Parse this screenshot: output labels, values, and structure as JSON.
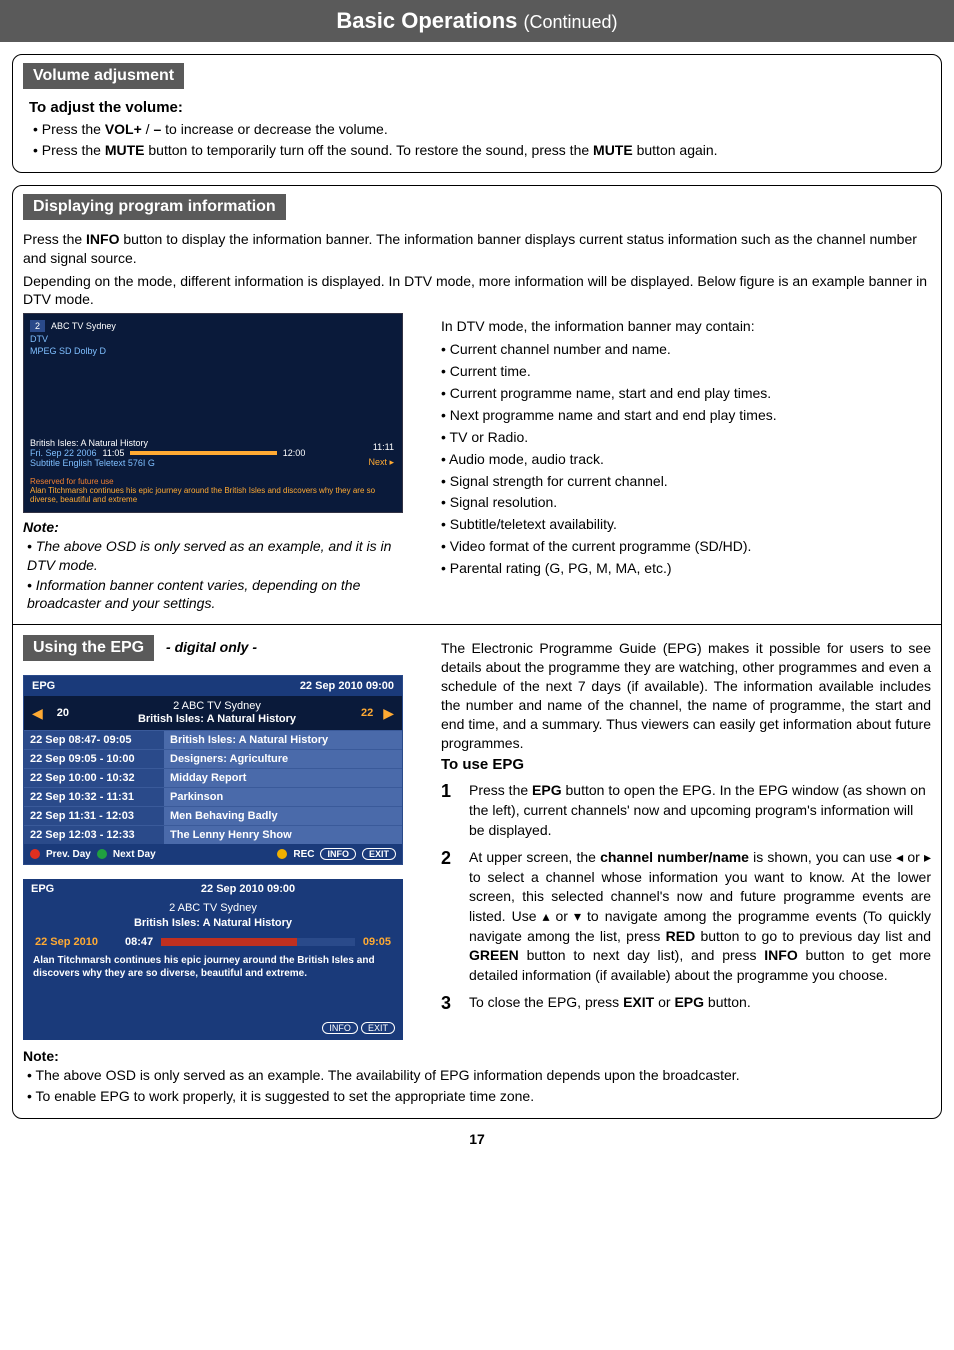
{
  "page": {
    "title_main": "Basic Operations",
    "title_cont": "(Continued)",
    "number": "17"
  },
  "vol": {
    "heading": "Volume adjusment",
    "sub": "To adjust the volume:",
    "b1_a": "Press the ",
    "b1_b": "VOL+",
    "b1_c": " / ",
    "b1_d": "–",
    "b1_e": "  to increase or decrease the volume.",
    "b2_a": "Press the ",
    "b2_b": "MUTE",
    "b2_c": " button to temporarily turn off the sound.   To restore the sound, press the ",
    "b2_d": "MUTE",
    "b2_e": " button again."
  },
  "disp": {
    "heading": "Displaying program information",
    "p1_a": "Press the ",
    "p1_b": "INFO",
    "p1_c": " button to display the information banner. The information banner displays current status information such as the channel number and signal source.",
    "p2": "Depending on the mode, different information is displayed. In DTV mode, more information will be displayed. Below figure is an example banner in DTV mode.",
    "osd": {
      "chno": "2",
      "chname": "ABC TV Sydney",
      "sub1": "DTV",
      "sub2": "MPEG SD Dolby D",
      "prog": "British Isles: A Natural History",
      "date": "Fri. Sep 22 2006",
      "t1": "11:05",
      "t2": "12:00",
      "clock": "11:11",
      "next": "Next  ▸",
      "subline": "Subtitle    English      Teletext    576I    G",
      "res": "Reserved for future use",
      "desc": "Alan Titchmarsh continues his epic journey around the British Isles and discovers why they are so diverse, beautiful and extreme"
    },
    "note_lbl": "Note:",
    "note1": "The above OSD is only served as an example, and it is in DTV mode.",
    "note2": "Information banner content varies, depending on the broadcaster and your settings.",
    "rlead": "In DTV mode, the information banner may contain:",
    "ritems": [
      "Current channel number and name.",
      "Current time.",
      "Current programme name, start and end play times.",
      "Next programme name and start and end play times.",
      "TV or Radio.",
      "Audio mode, audio track.",
      "Signal strength for current channel.",
      "Signal resolution.",
      "Subtitle/teletext availability.",
      "Video format of the current programme (SD/HD).",
      "Parental rating (G, PG, M, MA, etc.)"
    ]
  },
  "epg": {
    "heading": "Using the EPG",
    "digital": "- digital only -",
    "list": {
      "title_l": "EPG",
      "title_r": "22 Sep 2010   09:00",
      "chno_l": "20",
      "mid_line1": "2     ABC   TV  Sydney",
      "mid_line2": "British Isles: A Natural History",
      "chno_r": "22",
      "rows": [
        {
          "t": "22 Sep  08:47- 09:05",
          "p": "British Isles: A Natural History"
        },
        {
          "t": "22 Sep  09:05 - 10:00",
          "p": "Designers: Agriculture"
        },
        {
          "t": "22 Sep  10:00 - 10:32",
          "p": "Midday Report"
        },
        {
          "t": "22 Sep  10:32 - 11:31",
          "p": "Parkinson"
        },
        {
          "t": "22 Sep  11:31 - 12:03",
          "p": "Men Behaving Badly"
        },
        {
          "t": "22 Sep  12:03 - 12:33",
          "p": "The Lenny Henry Show"
        }
      ],
      "foot_prev": "Prev. Day",
      "foot_next": "Next Day",
      "foot_rec": "REC",
      "foot_info": "INFO",
      "foot_exit": "EXIT"
    },
    "detail": {
      "title_l": "EPG",
      "title_r": "22 Sep 2010   09:00",
      "mid_line1": "2     ABC   TV  Sydney",
      "mid_line2": "British Isles: A Natural History",
      "date": "22 Sep 2010",
      "t1": "08:47",
      "t2": "09:05",
      "desc": "Alan Titchmarsh continues his epic journey around the British Isles and discovers why they are so diverse, beautiful and extreme.",
      "foot_info": "INFO",
      "foot_exit": "EXIT"
    },
    "intro": "The Electronic Programme Guide (EPG) makes it possible for users to see details about the programme they are watching, other programmes and even a schedule of the next 7 days (if available). The information available includes the number and name of the channel, the name of programme, the start and end time, and a summary. Thus viewers can easily get information about future programmes.",
    "touse": "To use EPG",
    "n1a": "Press the ",
    "n1b": "EPG",
    "n1c": " button to open the EPG. In the EPG window (as shown on the left), current channels' now and upcoming program's information will be displayed.",
    "n2a": "At upper screen, the ",
    "n2b": "channel number/name",
    "n2c": " is shown, you can use ◂ or ▸ to select a channel whose information you want to know. At the lower screen, this selected channel's now and future programme events are listed. Use ▴ or ▾ to navigate among the programme events (To quickly navigate among the list, press ",
    "n2d": "RED",
    "n2e": " button to go to previous day list and ",
    "n2f": "GREEN",
    "n2g": " button to next day list), and press ",
    "n2h": "INFO",
    "n2i": " button to get more detailed information (if available) about the programme you choose.",
    "n3a": "To close the EPG, press ",
    "n3b": "EXIT",
    "n3c": " or ",
    "n3d": "EPG",
    "n3e": " button.",
    "note_lbl": "Note:",
    "note_b1": "The above OSD is only served as an example. The availability of EPG information depends upon the broadcaster.",
    "note_b2": "To enable EPG to work properly, it is suggested to set the appropriate time zone."
  }
}
